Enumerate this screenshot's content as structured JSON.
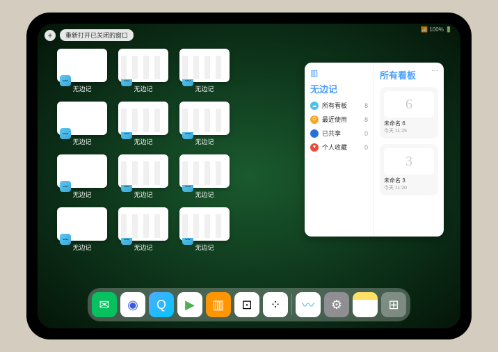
{
  "status": "📶 100% 🔋",
  "plus": "+",
  "reopen": "重新打开已关闭的窗口",
  "windows": [
    {
      "name": "无边记",
      "cal": false
    },
    {
      "name": "无边记",
      "cal": true
    },
    {
      "name": "无边记",
      "cal": true
    },
    {
      "name": "无边记",
      "cal": false
    },
    {
      "name": "无边记",
      "cal": true
    },
    {
      "name": "无边记",
      "cal": true
    },
    {
      "name": "无边记",
      "cal": false
    },
    {
      "name": "无边记",
      "cal": true
    },
    {
      "name": "无边记",
      "cal": true
    },
    {
      "name": "无边记",
      "cal": false
    },
    {
      "name": "无边记",
      "cal": true
    },
    {
      "name": "无边记",
      "cal": true
    }
  ],
  "appbadge": "〰",
  "panel": {
    "more": "···",
    "left_title": "无边记",
    "rows": [
      {
        "color": "#4ac0e8",
        "icon": "☁",
        "label": "所有看板",
        "count": "8"
      },
      {
        "color": "#f5a623",
        "icon": "⏱",
        "label": "最近使用",
        "count": "8"
      },
      {
        "color": "#2e6fd9",
        "icon": "👤",
        "label": "已共享",
        "count": "0"
      },
      {
        "color": "#e74c3c",
        "icon": "♥",
        "label": "个人收藏",
        "count": "0"
      }
    ],
    "right_title": "所有看板",
    "cards": [
      {
        "sketch": "6",
        "name": "未命名 6",
        "date": "今天 11:25"
      },
      {
        "sketch": "3",
        "name": "未命名 3",
        "date": "今天 11:20"
      }
    ]
  },
  "dock": [
    {
      "name": "wechat-icon",
      "bg": "#07c160",
      "glyph": "✉"
    },
    {
      "name": "quark-icon",
      "bg": "#fff",
      "glyph": "◉",
      "fg": "#3b5bdb"
    },
    {
      "name": "browser-icon",
      "bg": "linear-gradient(135deg,#4facfe,#00c6ff)",
      "glyph": "Q"
    },
    {
      "name": "play-icon",
      "bg": "#fff",
      "glyph": "▶",
      "fg": "#4caf50"
    },
    {
      "name": "books-icon",
      "bg": "#ff9500",
      "glyph": "▥"
    },
    {
      "name": "dice-icon",
      "bg": "#fff",
      "glyph": "⊡",
      "fg": "#000"
    },
    {
      "name": "share-icon",
      "bg": "#fff",
      "glyph": "⁘",
      "fg": "#000"
    },
    {
      "name": "freeform-icon",
      "bg": "#fff",
      "glyph": "〰",
      "fg": "#4ac0e8"
    },
    {
      "name": "settings-icon",
      "bg": "#8e8e93",
      "glyph": "⚙"
    },
    {
      "name": "notes-icon",
      "bg": "linear-gradient(#ffe066 30%,#fff 30%)",
      "glyph": ""
    },
    {
      "name": "appgrid-icon",
      "bg": "rgba(255,255,255,.3)",
      "glyph": "⊞"
    }
  ]
}
